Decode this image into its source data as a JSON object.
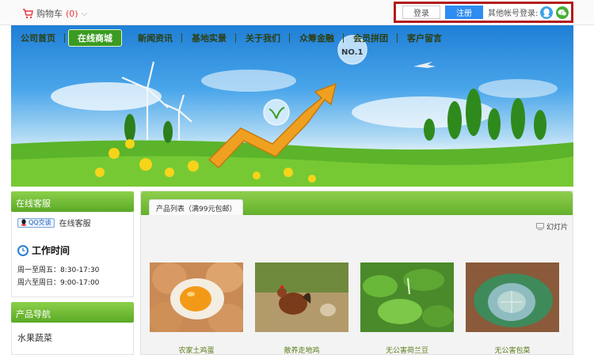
{
  "topbar": {
    "cart_label": "购物车",
    "cart_count": "(0)",
    "login": "登录",
    "register": "注册",
    "other_login": "其他帐号登录:"
  },
  "nav": [
    "公司首页",
    "在线商城",
    "新闻资讯",
    "基地实景",
    "关于我们",
    "众筹金融",
    "会员拼团",
    "客户留言"
  ],
  "banner": {
    "badge": "NO.1"
  },
  "sidebar": {
    "service_title": "在线客服",
    "qq_badge": "QQ交谈",
    "qq_label": "在线客服",
    "work_title": "工作时间",
    "hours": [
      "周一至周五：8:30-17:30",
      "周六至周日：9:00-17:00"
    ],
    "category_title": "产品导航",
    "categories": [
      "水果蔬菜"
    ]
  },
  "main": {
    "tab": "产品列表（满99元包邮）",
    "slideshow": "幻灯片",
    "products": [
      {
        "name": "农家土鸡蛋"
      },
      {
        "name": "散养走地鸡"
      },
      {
        "name": "无公害荷兰豆"
      },
      {
        "name": "无公害包菜"
      }
    ]
  },
  "colors": {
    "accent_green": "#5aa927",
    "register_blue": "#2f8cf0",
    "highlight_red": "#b31b1b"
  }
}
